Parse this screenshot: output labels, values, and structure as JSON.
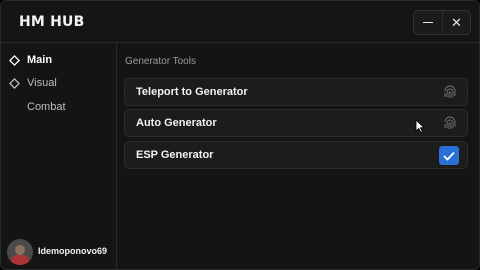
{
  "app": {
    "title": "HM HUB"
  },
  "window_controls": {
    "minimize": "minimize",
    "close": "✕"
  },
  "sidebar": {
    "items": [
      {
        "label": "Main",
        "icon": "diamond-icon",
        "active": true
      },
      {
        "label": "Visual",
        "icon": "diamond-icon",
        "active": false
      },
      {
        "label": "Combat",
        "icon": "",
        "active": false
      }
    ],
    "user": {
      "name": "Idemoponovo69"
    }
  },
  "main": {
    "section_title": "Generator Tools",
    "rows": [
      {
        "label": "Teleport to Generator",
        "control": "fingerprint-icon"
      },
      {
        "label": "Auto Generator",
        "control": "fingerprint-icon"
      },
      {
        "label": "ESP Generator",
        "control": "checkbox",
        "checked": true
      }
    ]
  },
  "colors": {
    "accent": "#2a6fd6",
    "background": "#141414",
    "row": "#1c1c1c"
  }
}
